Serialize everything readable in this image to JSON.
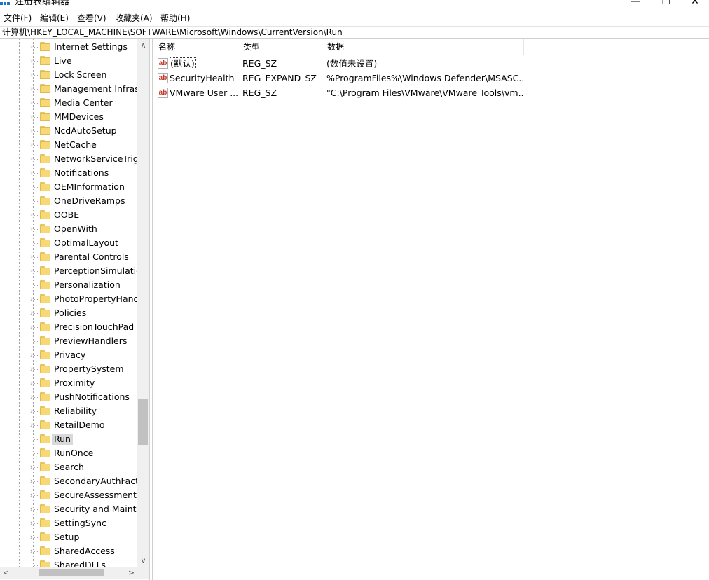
{
  "window": {
    "title": "注册表编辑器",
    "minimize_glyph": "—",
    "maximize_glyph": "❐",
    "close_glyph": "✕"
  },
  "menu": {
    "file": "文件(F)",
    "edit": "编辑(E)",
    "view": "查看(V)",
    "favorites": "收藏夹(A)",
    "help": "帮助(H)"
  },
  "address": "计算机\\HKEY_LOCAL_MACHINE\\SOFTWARE\\Microsoft\\Windows\\CurrentVersion\\Run",
  "tree": {
    "items": [
      {
        "label": "Internet Settings",
        "expandable": true
      },
      {
        "label": "Live",
        "expandable": true
      },
      {
        "label": "Lock Screen",
        "expandable": true
      },
      {
        "label": "Management Infrast",
        "expandable": true
      },
      {
        "label": "Media Center",
        "expandable": true
      },
      {
        "label": "MMDevices",
        "expandable": true
      },
      {
        "label": "NcdAutoSetup",
        "expandable": true
      },
      {
        "label": "NetCache",
        "expandable": true
      },
      {
        "label": "NetworkServiceTrigg",
        "expandable": true
      },
      {
        "label": "Notifications",
        "expandable": true
      },
      {
        "label": "OEMInformation",
        "expandable": false
      },
      {
        "label": "OneDriveRamps",
        "expandable": false
      },
      {
        "label": "OOBE",
        "expandable": true
      },
      {
        "label": "OpenWith",
        "expandable": true
      },
      {
        "label": "OptimalLayout",
        "expandable": false
      },
      {
        "label": "Parental Controls",
        "expandable": true
      },
      {
        "label": "PerceptionSimulation",
        "expandable": true
      },
      {
        "label": "Personalization",
        "expandable": false
      },
      {
        "label": "PhotoPropertyHandl",
        "expandable": true
      },
      {
        "label": "Policies",
        "expandable": true
      },
      {
        "label": "PrecisionTouchPad",
        "expandable": true
      },
      {
        "label": "PreviewHandlers",
        "expandable": false
      },
      {
        "label": "Privacy",
        "expandable": true
      },
      {
        "label": "PropertySystem",
        "expandable": true
      },
      {
        "label": "Proximity",
        "expandable": true
      },
      {
        "label": "PushNotifications",
        "expandable": true
      },
      {
        "label": "Reliability",
        "expandable": true
      },
      {
        "label": "RetailDemo",
        "expandable": true
      },
      {
        "label": "Run",
        "expandable": false,
        "selected": true
      },
      {
        "label": "RunOnce",
        "expandable": false
      },
      {
        "label": "Search",
        "expandable": true
      },
      {
        "label": "SecondaryAuthFacto",
        "expandable": true
      },
      {
        "label": "SecureAssessment",
        "expandable": true
      },
      {
        "label": "Security and Mainter",
        "expandable": true
      },
      {
        "label": "SettingSync",
        "expandable": true
      },
      {
        "label": "Setup",
        "expandable": true
      },
      {
        "label": "SharedAccess",
        "expandable": true
      },
      {
        "label": "SharedDLLs",
        "expandable": false
      }
    ]
  },
  "list": {
    "columns": {
      "name": "名称",
      "type": "类型",
      "data": "数据"
    },
    "rows": [
      {
        "name": "(默认)",
        "type": "REG_SZ",
        "data": "(数值未设置)"
      },
      {
        "name": "SecurityHealth",
        "type": "REG_EXPAND_SZ",
        "data": "%ProgramFiles%\\Windows Defender\\MSASC..."
      },
      {
        "name": "VMware User ...",
        "type": "REG_SZ",
        "data": "\"C:\\Program Files\\VMware\\VMware Tools\\vm..."
      }
    ],
    "value_icon_text": "ab"
  },
  "scroll": {
    "up_glyph": "∧",
    "down_glyph": "∨",
    "left_glyph": "<",
    "right_glyph": ">"
  },
  "colors": {
    "folder": "#f8d775",
    "selection": "#d9d9d9",
    "value_icon": "#c0392b"
  }
}
